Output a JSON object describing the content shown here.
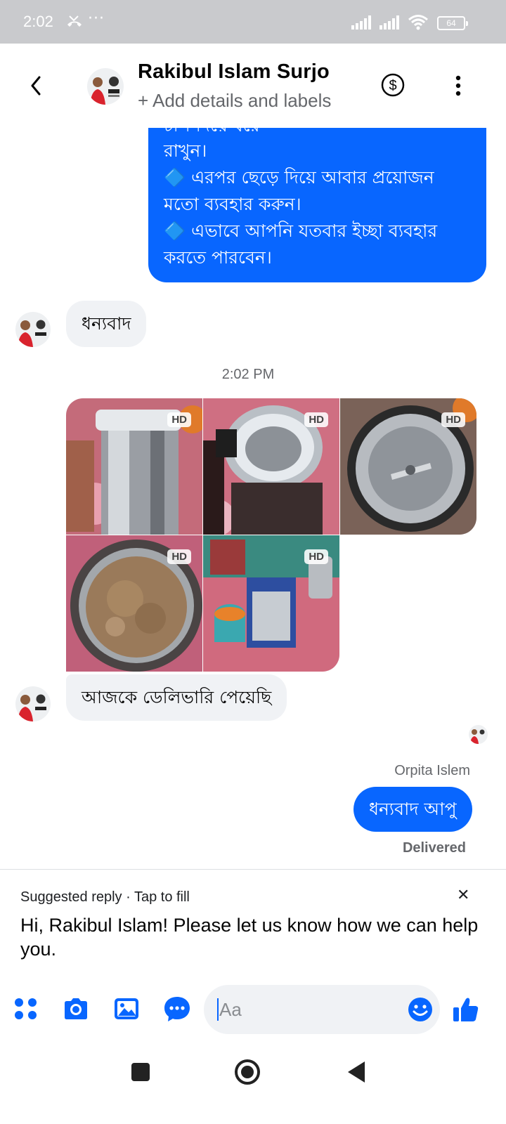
{
  "status_bar": {
    "time": "2:02",
    "more": "···",
    "battery": "64"
  },
  "header": {
    "name": "Rakibul Islam Surjo",
    "subtitle": "+ Add details and labels"
  },
  "messages": {
    "outgoing_long": {
      "partial_line": "  চাপ দিয়ে  ধরে",
      "lines": [
        "রাখুন।",
        "🔷 এরপর ছেড়ে দিয়ে আবার প্রয়োজন",
        "মতো ব্যবহার করুন।",
        "🔷 এভাবে আপনি যতবার ইচ্ছা ব্যবহার",
        "করতে পারবেন।"
      ]
    },
    "incoming_thanks": "ধন্যবাদ",
    "timestamp": "2:02 PM",
    "photo_badge": "HD",
    "incoming_delivery": "আজকে ডেলিভারি পেয়েছি",
    "sender_name": "Orpita Islem",
    "outgoing_reply": "ধন্যবাদ আপু",
    "status": "Delivered"
  },
  "suggested_reply": {
    "header": "Suggested reply · Tap to fill",
    "close": "✕",
    "text": "Hi, Rakibul Islam! Please let us know how we can help you."
  },
  "composer": {
    "placeholder": "Aa",
    "value": ""
  },
  "colors": {
    "accent": "#0866ff",
    "bubble_grey": "#f0f2f5",
    "status_bar": "#c9cacd",
    "secondary_text": "#65676b"
  },
  "icons": {
    "back": "chevron-left-icon",
    "payment": "dollar-circle-icon",
    "more": "vertical-dots-icon",
    "apps": "four-dots-icon",
    "camera": "camera-icon",
    "gallery": "image-icon",
    "chat": "chat-bubble-icon",
    "emoji": "smiley-icon",
    "like": "thumbs-up-icon"
  }
}
